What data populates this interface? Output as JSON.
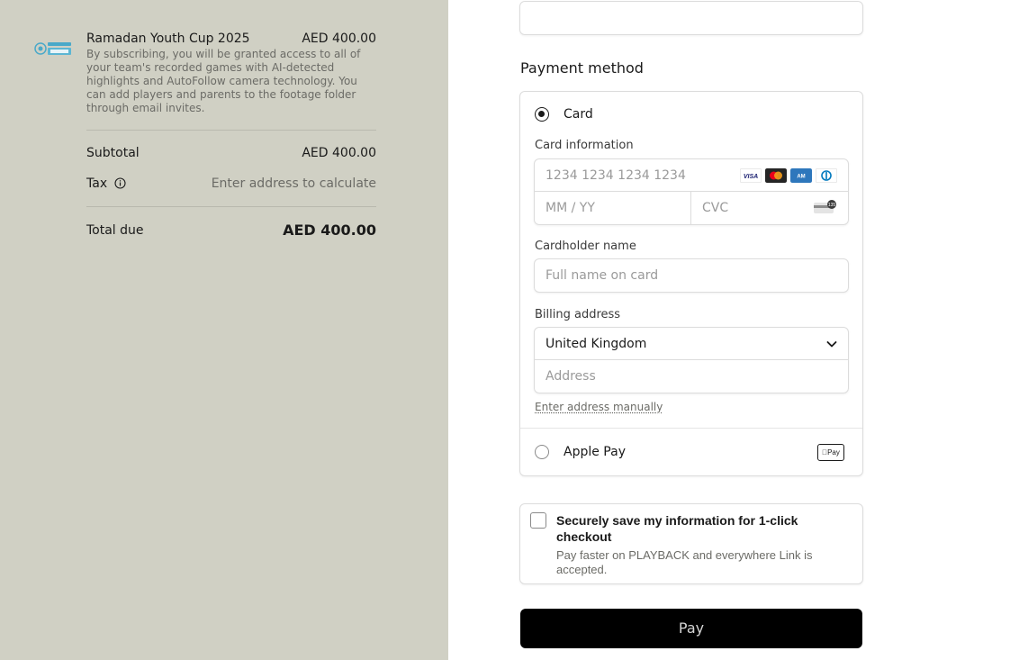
{
  "summary": {
    "logo": "tournament-logo",
    "product_name": "Ramadan Youth Cup 2025",
    "product_price": "AED 400.00",
    "product_description": "By subscribing, you will be granted access to all of your team's recorded games with AI-detected highlights and AutoFollow camera technology. You can add players and parents to the footage folder through email invites.",
    "subtotal_label": "Subtotal",
    "subtotal_value": "AED 400.00",
    "tax_label": "Tax",
    "tax_value": "Enter address to calculate",
    "total_label": "Total due",
    "total_value": "AED 400.00"
  },
  "payment": {
    "section_title": "Payment method",
    "card_option_label": "Card",
    "card_selected": true,
    "card_info_label": "Card information",
    "card_number_placeholder": "1234 1234 1234 1234",
    "card_brands": [
      "visa-icon",
      "mastercard-icon",
      "amex-icon",
      "diners-icon"
    ],
    "expiry_placeholder": "MM / YY",
    "cvc_placeholder": "CVC",
    "cardholder_label": "Cardholder name",
    "cardholder_placeholder": "Full name on card",
    "billing_label": "Billing address",
    "country_value": "United Kingdom",
    "address_placeholder": "Address",
    "manual_address_link": "Enter address manually",
    "apple_pay_label": "Apple Pay",
    "apple_pay_badge": "Pay"
  },
  "save_info": {
    "title": "Securely save my information for 1-click checkout",
    "subtitle": "Pay faster on PLAYBACK and everywhere Link is accepted.",
    "checked": false
  },
  "pay_button": {
    "label": "Pay"
  },
  "colors": {
    "left_background": "#d0d0c4",
    "pay_button": "#000000",
    "visa": "#1a1f71",
    "mastercard_red": "#eb001b",
    "mastercard_yellow": "#f79e1b",
    "amex": "#2e77bc",
    "diners": "#0079be"
  }
}
